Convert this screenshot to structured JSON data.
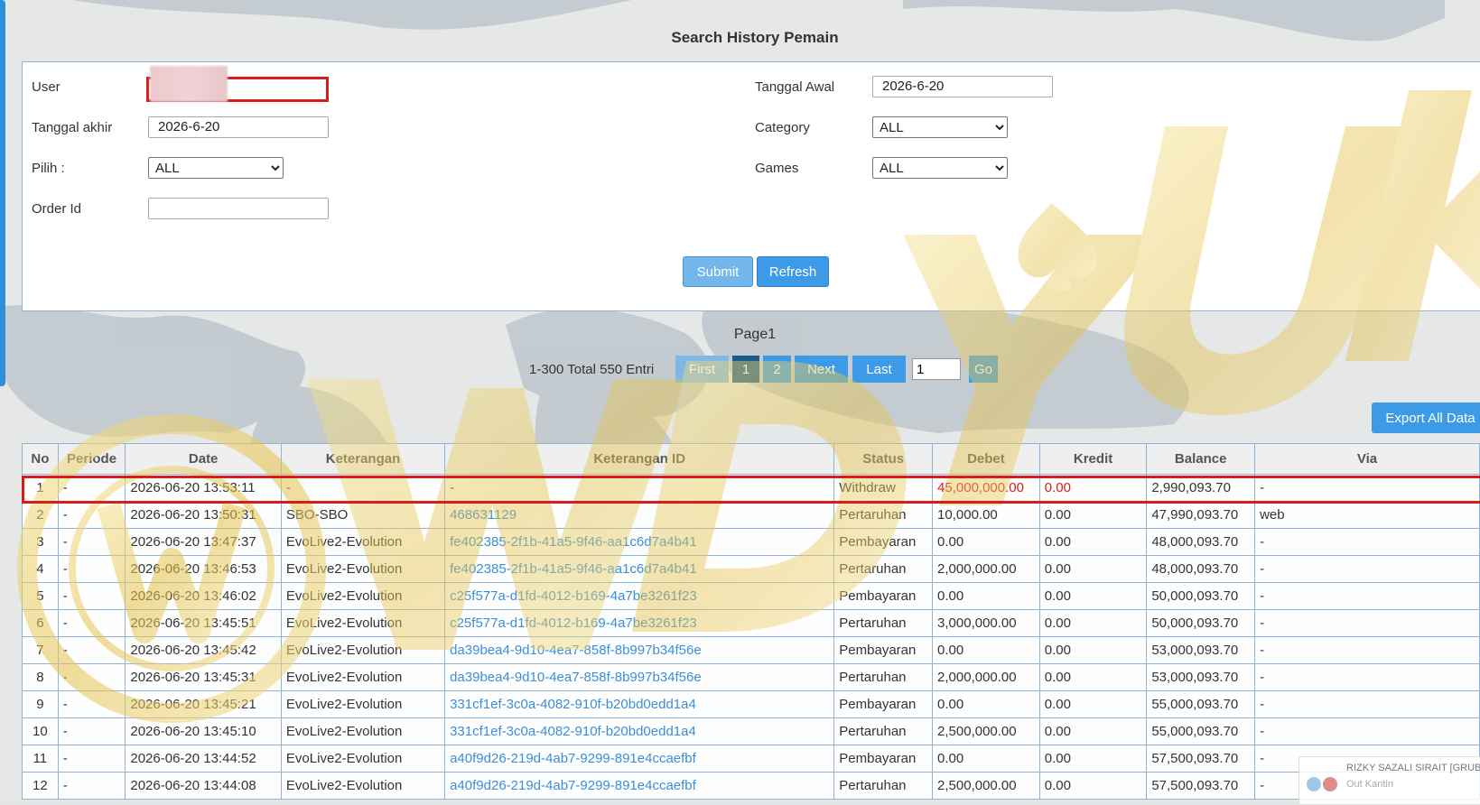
{
  "page": {
    "title": "Search History Pemain"
  },
  "form": {
    "user_label": "User",
    "user_value": "",
    "tanggal_awal_label": "Tanggal Awal",
    "tanggal_awal_value": "2026-6-20",
    "tanggal_akhir_label": "Tanggal akhir",
    "tanggal_akhir_value": "2026-6-20",
    "category_label": "Category",
    "category_value": "ALL",
    "pilih_label": "Pilih  :",
    "pilih_value": "ALL",
    "games_label": "Games",
    "games_value": "ALL",
    "order_id_label": "Order Id",
    "order_id_value": "",
    "submit_label": "Submit",
    "refresh_label": "Refresh"
  },
  "pager": {
    "page_label": "Page1",
    "info": "1-300 Total 550 Entri",
    "first": "First",
    "page1": "1",
    "page2": "2",
    "next": "Next",
    "last": "Last",
    "goto_value": "1",
    "go": "Go"
  },
  "export_label": "Export All Data",
  "table": {
    "columns": [
      "No",
      "Periode",
      "Date",
      "Keterangan",
      "Keterangan ID",
      "Status",
      "Debet",
      "Kredit",
      "Balance",
      "Via"
    ],
    "rows": [
      [
        "1",
        "-",
        "2026-06-20 13:53:11",
        "-",
        "-",
        "Withdraw",
        "45,000,000.00",
        "0.00",
        "2,990,093.70",
        "-"
      ],
      [
        "2",
        "-",
        "2026-06-20 13:50:31",
        "SBO-SBO",
        "468631129",
        "Pertaruhan",
        "10,000.00",
        "0.00",
        "47,990,093.70",
        "web"
      ],
      [
        "3",
        "-",
        "2026-06-20 13:47:37",
        "EvoLive2-Evolution",
        "fe402385-2f1b-41a5-9f46-aa1c6d7a4b41",
        "Pembayaran",
        "0.00",
        "0.00",
        "48,000,093.70",
        "-"
      ],
      [
        "4",
        "-",
        "2026-06-20 13:46:53",
        "EvoLive2-Evolution",
        "fe402385-2f1b-41a5-9f46-aa1c6d7a4b41",
        "Pertaruhan",
        "2,000,000.00",
        "0.00",
        "48,000,093.70",
        "-"
      ],
      [
        "5",
        "-",
        "2026-06-20 13:46:02",
        "EvoLive2-Evolution",
        "c25f577a-d1fd-4012-b169-4a7be3261f23",
        "Pembayaran",
        "0.00",
        "0.00",
        "50,000,093.70",
        "-"
      ],
      [
        "6",
        "-",
        "2026-06-20 13:45:51",
        "EvoLive2-Evolution",
        "c25f577a-d1fd-4012-b169-4a7be3261f23",
        "Pertaruhan",
        "3,000,000.00",
        "0.00",
        "50,000,093.70",
        "-"
      ],
      [
        "7",
        "-",
        "2026-06-20 13:45:42",
        "EvoLive2-Evolution",
        "da39bea4-9d10-4ea7-858f-8b997b34f56e",
        "Pembayaran",
        "0.00",
        "0.00",
        "53,000,093.70",
        "-"
      ],
      [
        "8",
        "-",
        "2026-06-20 13:45:31",
        "EvoLive2-Evolution",
        "da39bea4-9d10-4ea7-858f-8b997b34f56e",
        "Pertaruhan",
        "2,000,000.00",
        "0.00",
        "53,000,093.70",
        "-"
      ],
      [
        "9",
        "-",
        "2026-06-20 13:45:21",
        "EvoLive2-Evolution",
        "331cf1ef-3c0a-4082-910f-b20bd0edd1a4",
        "Pembayaran",
        "0.00",
        "0.00",
        "55,000,093.70",
        "-"
      ],
      [
        "10",
        "-",
        "2026-06-20 13:45:10",
        "EvoLive2-Evolution",
        "331cf1ef-3c0a-4082-910f-b20bd0edd1a4",
        "Pertaruhan",
        "2,500,000.00",
        "0.00",
        "55,000,093.70",
        "-"
      ],
      [
        "11",
        "-",
        "2026-06-20 13:44:52",
        "EvoLive2-Evolution",
        "a40f9d26-219d-4ab7-9299-891e4ccaefbf",
        "Pembayaran",
        "0.00",
        "0.00",
        "57,500,093.70",
        "-"
      ],
      [
        "12",
        "-",
        "2026-06-20 13:44:08",
        "EvoLive2-Evolution",
        "a40f9d26-219d-4ab7-9299-891e4ccaefbf",
        "Pertaruhan",
        "2,500,000.00",
        "0.00",
        "57,500,093.70",
        "-"
      ]
    ]
  },
  "toast": {
    "title": "RIZKY SAZALI SIRAIT [GRUB",
    "subtitle": "Out Kantin"
  },
  "colors": {
    "accent": "#3d9ae6",
    "highlight": "#d81b1b",
    "link": "#3a8fd6"
  },
  "icons": [
    "user-avatar-icon",
    "heart-icon"
  ]
}
